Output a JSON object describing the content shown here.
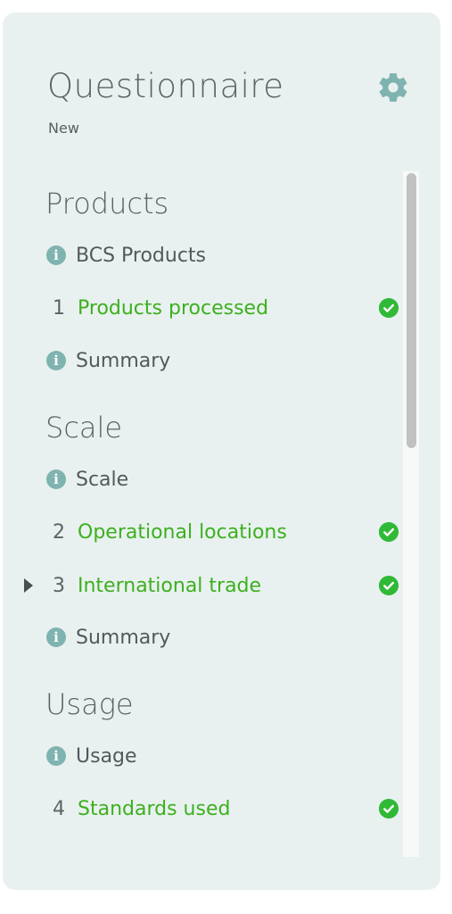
{
  "header": {
    "title": "Questionnaire",
    "status": "New",
    "settings_icon": "gear-icon"
  },
  "colors": {
    "panel_bg": "#e9f1f0",
    "complete_text": "#3cb01e",
    "check_badge": "#30b936",
    "info_icon": "#7fb3b0",
    "gear": "#7fb3b0"
  },
  "sections": [
    {
      "title": "Products",
      "items": [
        {
          "kind": "info",
          "icon": "i",
          "label": "BCS Products"
        },
        {
          "kind": "question",
          "number": "1",
          "label": "Products processed",
          "complete": true
        },
        {
          "kind": "info",
          "icon": "i",
          "label": "Summary"
        }
      ]
    },
    {
      "title": "Scale",
      "items": [
        {
          "kind": "info",
          "icon": "i",
          "label": "Scale"
        },
        {
          "kind": "question",
          "number": "2",
          "label": "Operational locations",
          "complete": true
        },
        {
          "kind": "question",
          "number": "3",
          "label": "International trade",
          "complete": true,
          "current": true
        },
        {
          "kind": "info",
          "icon": "i",
          "label": "Summary"
        }
      ]
    },
    {
      "title": "Usage",
      "items": [
        {
          "kind": "info",
          "icon": "i",
          "label": "Usage"
        },
        {
          "kind": "question",
          "number": "4",
          "label": "Standards used",
          "complete": true
        }
      ]
    }
  ]
}
